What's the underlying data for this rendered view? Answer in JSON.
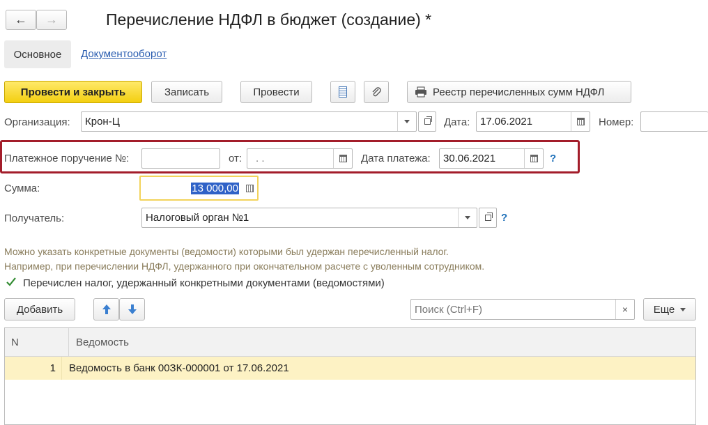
{
  "header": {
    "title": "Перечисление НДФЛ в бюджет (создание) *",
    "back": "←",
    "forward": "→"
  },
  "tabs": {
    "main": "Основное",
    "docflow": "Документооборот"
  },
  "toolbar": {
    "post_close": "Провести и закрыть",
    "save": "Записать",
    "post": "Провести",
    "registry": "Реестр перечисленных сумм НДФЛ"
  },
  "org": {
    "label": "Организация:",
    "value": "Крон-Ц"
  },
  "date": {
    "label": "Дата:",
    "value": "17.06.2021"
  },
  "number": {
    "label": "Номер:",
    "value": ""
  },
  "payment_order": {
    "label": "Платежное поручение №:",
    "value": "",
    "from_label": "от:",
    "from_value": " .  .",
    "pay_date_label": "Дата платежа:",
    "pay_date_value": "30.06.2021",
    "help": "?"
  },
  "sum": {
    "label": "Сумма:",
    "value": "13 000,00"
  },
  "recipient": {
    "label": "Получатель:",
    "value": "Налоговый орган №1",
    "help": "?"
  },
  "hint": {
    "line1": "Можно указать конкретные документы (ведомости) которыми был удержан перечисленный налог.",
    "line2": "Например, при перечислении НДФЛ, удержанного при окончательном расчете с уволенным сотрудником."
  },
  "checkbox": {
    "label": "Перечислен налог, удержанный конкретными документами (ведомостями)",
    "checked": true
  },
  "table_toolbar": {
    "add": "Добавить",
    "search_placeholder": "Поиск (Ctrl+F)",
    "clear": "×",
    "more": "Еще"
  },
  "table": {
    "columns": [
      "N",
      "Ведомость"
    ],
    "rows": [
      {
        "n": "1",
        "doc": "Ведомость в банк 00ЗК-000001 от 17.06.2021"
      }
    ]
  },
  "colors": {
    "highlight_border": "#a31d2a",
    "primary": "#f5d31a",
    "selected_row": "#fdf2c4",
    "link": "#2a5db0"
  }
}
